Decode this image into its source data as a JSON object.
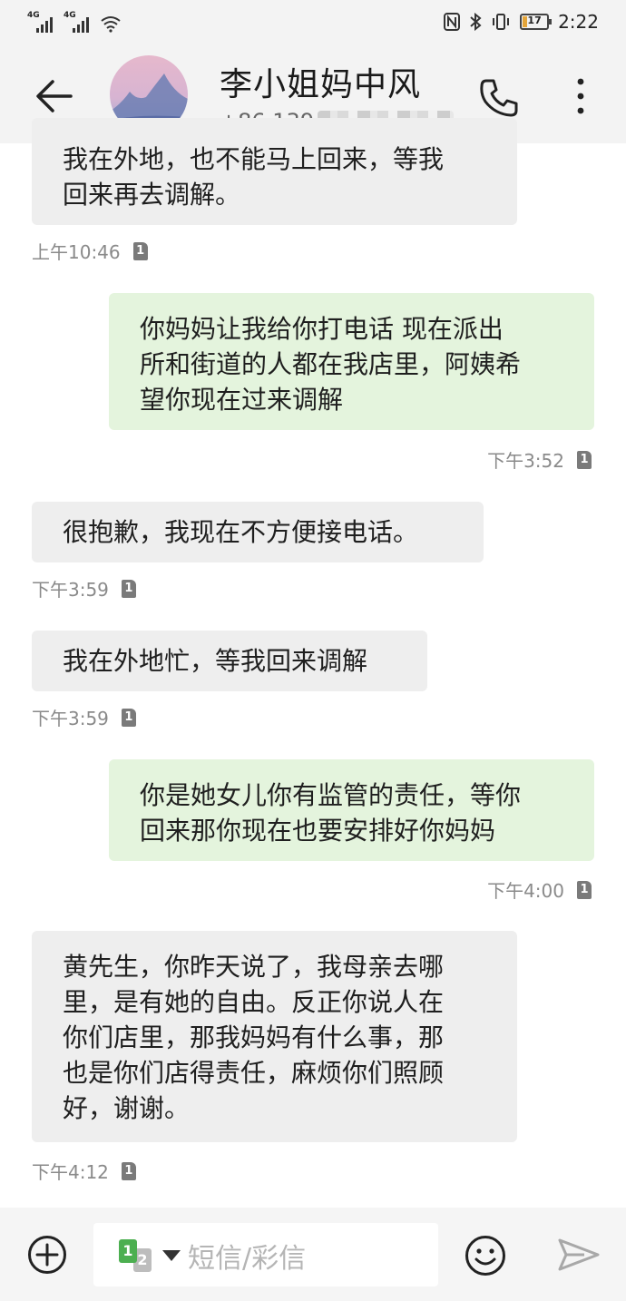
{
  "status_bar": {
    "sim1_label": "4G",
    "sim2_label": "4G",
    "battery_percent": "17",
    "battery_level": 0.17,
    "time": "2:22",
    "icons": [
      "signal-icon",
      "signal-icon",
      "wifi-icon",
      "nfc-icon",
      "bluetooth-icon",
      "vibrate-icon",
      "battery-icon"
    ]
  },
  "header": {
    "contact_name": "李小姐妈中风",
    "phone_prefix": "+86 139",
    "icons": [
      "back-arrow-icon",
      "avatar",
      "phone-call-icon",
      "more-vertical-icon"
    ]
  },
  "messages": [
    {
      "direction": "in",
      "lines": [
        "我在外地，也不能马上回来，等我",
        "回来再去调解。"
      ],
      "time": "上午10:46",
      "sim": "1"
    },
    {
      "direction": "out",
      "lines": [
        "你妈妈让我给你打电话 现在派出",
        "所和街道的人都在我店里，阿姨希",
        "望你现在过来调解"
      ],
      "time": "下午3:52",
      "sim": "1"
    },
    {
      "direction": "in",
      "lines": [
        "很抱歉，我现在不方便接电话。"
      ],
      "time": "下午3:59",
      "sim": "1"
    },
    {
      "direction": "in",
      "lines": [
        "我在外地忙，等我回来调解"
      ],
      "time": "下午3:59",
      "sim": "1"
    },
    {
      "direction": "out",
      "lines": [
        "你是她女儿你有监管的责任，等你",
        "回来那你现在也要安排好你妈妈"
      ],
      "time": "下午4:00",
      "sim": "1"
    },
    {
      "direction": "in",
      "lines": [
        "黄先生，你昨天说了，我母亲去哪",
        "里，是有她的自由。反正你说人在",
        "你们店里，那我妈妈有什么事，那",
        "也是你们店得责任，麻烦你们照顾",
        "好，谢谢。"
      ],
      "time": "下午4:12",
      "sim": "1"
    }
  ],
  "composer": {
    "sim_primary": "1",
    "sim_secondary": "2",
    "placeholder": "短信/彩信",
    "icons": [
      "add-icon",
      "emoji-icon",
      "send-icon"
    ]
  },
  "colors": {
    "incoming_bubble": "#eeeeee",
    "outgoing_bubble": "#e4f4dd",
    "header_bg": "#f3f3f3",
    "sim_active": "#4caf50"
  }
}
